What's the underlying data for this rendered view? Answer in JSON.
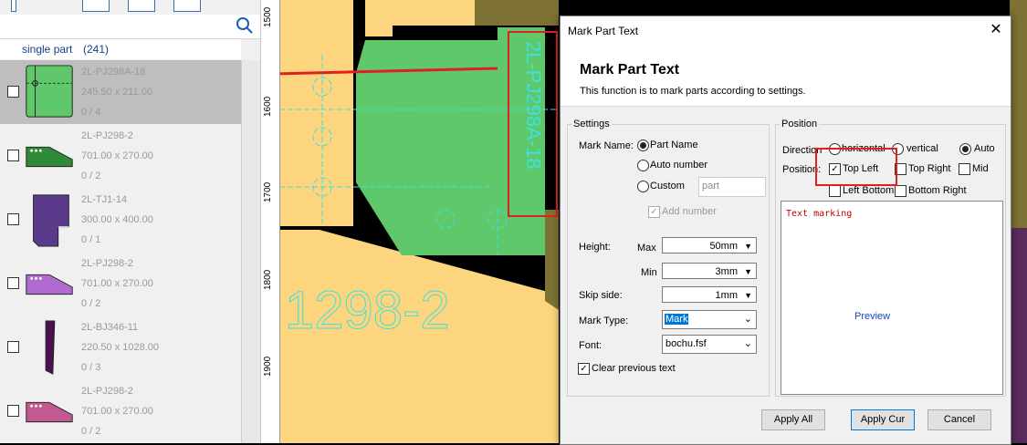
{
  "sidebar": {
    "header": {
      "label": "single part",
      "count": "(241)"
    },
    "parts": [
      {
        "name": "2L-PJ298A-18",
        "size": "245.50 x 211.00",
        "qty": "0 / 4",
        "color": "#5fc86a"
      },
      {
        "name": "2L-PJ298-2",
        "size": "701.00 x 270.00",
        "qty": "0 / 2",
        "color": "#2f8a3a"
      },
      {
        "name": "2L-TJ1-14",
        "size": "300.00 x 400.00",
        "qty": "0 / 1",
        "color": "#5a3a8a"
      },
      {
        "name": "2L-PJ298-2",
        "size": "701.00 x 270.00",
        "qty": "0 / 2",
        "color": "#b06ad0"
      },
      {
        "name": "2L-BJ346-11",
        "size": "220.50 x 1028.00",
        "qty": "0 / 3",
        "color": "#4a1050"
      },
      {
        "name": "2L-PJ298-2",
        "size": "701.00 x 270.00",
        "qty": "0 / 2",
        "color": "#c05a90"
      }
    ]
  },
  "canvas": {
    "ruler_labels": [
      "1500",
      "1600",
      "1700",
      "1800",
      "1900"
    ],
    "part_label_vertical": "2L-PJ298A-18",
    "part_label_bottom": "1298-2",
    "colors": {
      "sheet": "#000000",
      "orange": "#fcd57e",
      "green": "#5fc86a",
      "olive": "#7d7234",
      "purple": "#5b2a5d"
    }
  },
  "dialog": {
    "title": "Mark Part Text",
    "heading": "Mark Part Text",
    "description": "This function is to mark parts according to settings.",
    "settings": {
      "legend": "Settings",
      "mark_name_label": "Mark Name:",
      "opt_part_name": "Part Name",
      "opt_auto_number": "Auto number",
      "opt_custom": "Custom",
      "custom_placeholder": "part",
      "add_number": "Add number",
      "height_label": "Height:",
      "max_label": "Max",
      "max_value": "50mm",
      "min_label": "Min",
      "min_value": "3mm",
      "skip_label": "Skip side:",
      "skip_value": "1mm",
      "mark_type_label": "Mark Type:",
      "mark_type_value": "Mark",
      "font_label": "Font:",
      "font_value": "bochu.fsf",
      "clear_previous": "Clear previous text"
    },
    "position": {
      "legend": "Position",
      "direction_label": "Direction",
      "dir_horizontal": "horizontal",
      "dir_vertical": "vertical",
      "dir_auto": "Auto",
      "position_label": "Position:",
      "top_left": "Top Left",
      "top_right": "Top Right",
      "mid": "Mid",
      "left_bottom": "Left Bottom",
      "bottom_right": "Bottom Right",
      "preview_text": "Text marking",
      "preview_label": "Preview"
    },
    "buttons": {
      "apply_all": "Apply All",
      "apply_cur": "Apply Cur",
      "cancel": "Cancel"
    }
  }
}
